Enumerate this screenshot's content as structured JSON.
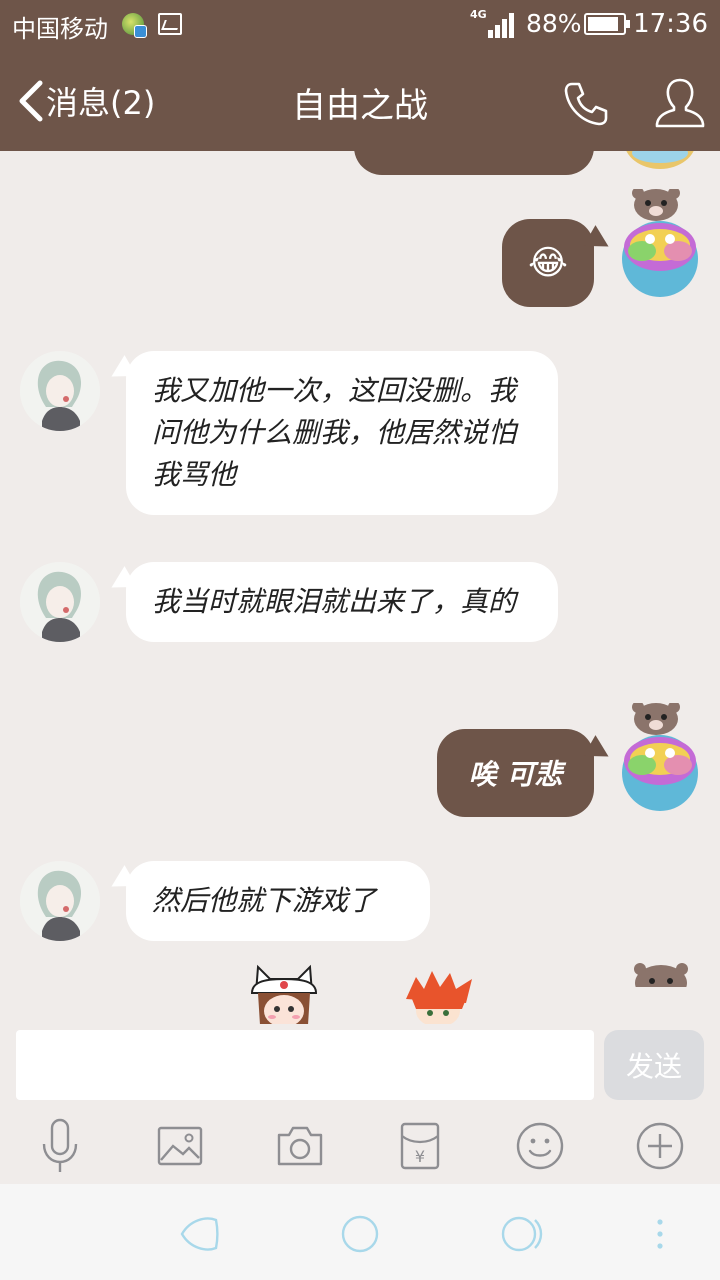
{
  "status_bar": {
    "carrier": "中国移动",
    "network": "4G",
    "battery": "88%",
    "time": "17:36"
  },
  "header": {
    "back_label": "消息(2)",
    "title": "自由之战"
  },
  "messages": [
    {
      "side": "out",
      "kind": "emoji",
      "text": "😂"
    },
    {
      "side": "in",
      "kind": "text",
      "text": "我又加他一次，这回没删。我问他为什么删我，他居然说怕我骂他"
    },
    {
      "side": "in",
      "kind": "text",
      "text": "我当时就眼泪就出来了，真的"
    },
    {
      "side": "out",
      "kind": "text",
      "text": "唉 可悲"
    },
    {
      "side": "in",
      "kind": "text",
      "text": "然后他就下游戏了"
    }
  ],
  "composer": {
    "value": "",
    "send_label": "发送"
  },
  "colors": {
    "header_bg": "#6e5549",
    "out_bubble": "#6e5549",
    "in_bubble": "#ffffff",
    "chat_bg": "#f0ecea",
    "send_disabled": "#dbdcdf"
  },
  "toolbar_icons": [
    "microphone-icon",
    "image-icon",
    "camera-icon",
    "red-packet-icon",
    "emoji-icon",
    "plus-icon"
  ],
  "system_nav_icons": [
    "back-icon",
    "home-icon",
    "recents-icon",
    "menu-icon"
  ]
}
